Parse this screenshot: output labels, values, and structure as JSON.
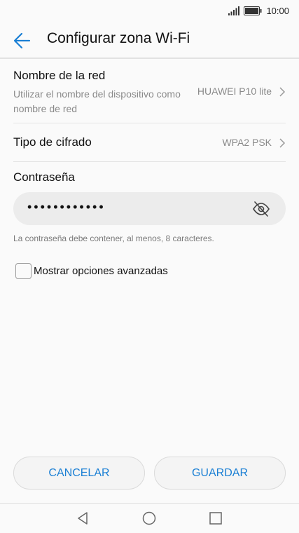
{
  "status": {
    "time": "10:00"
  },
  "header": {
    "title": "Configurar zona Wi-Fi"
  },
  "network_name": {
    "title": "Nombre de la red",
    "subtitle": "Utilizar el nombre del dispositivo como nombre de red",
    "value": "HUAWEI P10 lite"
  },
  "encryption": {
    "title": "Tipo de cifrado",
    "value": "WPA2 PSK"
  },
  "password": {
    "title": "Contraseña",
    "value": "••••••••••••",
    "hint": "La contraseña debe contener, al menos, 8 caracteres."
  },
  "advanced": {
    "label": "Mostrar opciones avanzadas",
    "checked": false
  },
  "buttons": {
    "cancel": "CANCELAR",
    "save": "GUARDAR"
  },
  "icons": {
    "back": "arrow-left-icon",
    "chevron": "chevron-right-icon",
    "eye": "eye-off-icon",
    "signal": "signal-icon",
    "battery": "battery-icon",
    "nav_back": "triangle-back-icon",
    "nav_home": "circle-home-icon",
    "nav_recent": "square-recent-icon"
  },
  "colors": {
    "accent": "#1a7fd4"
  }
}
